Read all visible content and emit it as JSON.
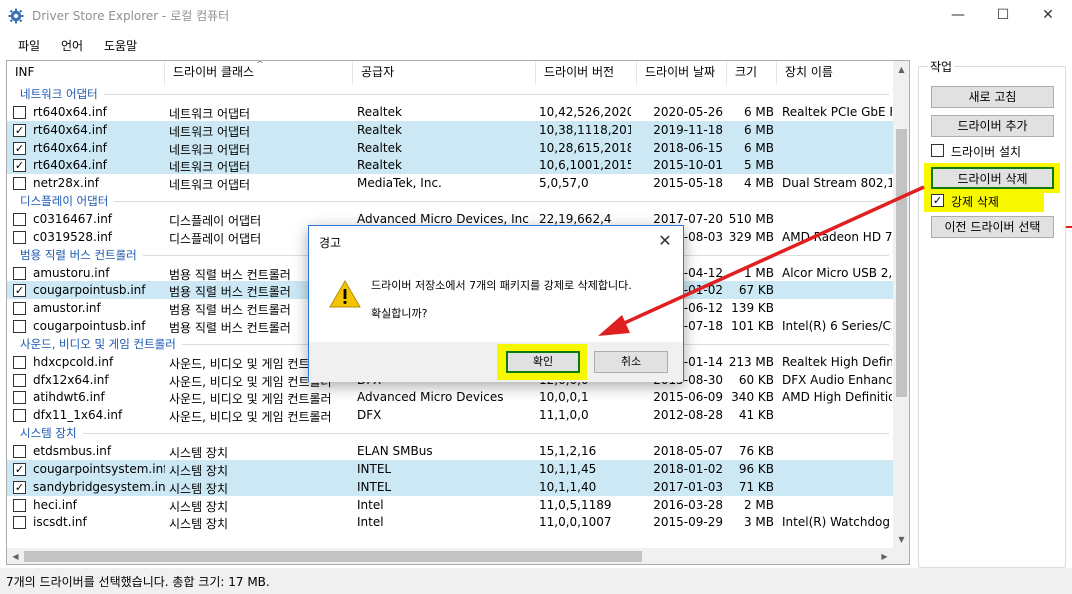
{
  "window": {
    "title": "Driver Store Explorer - 로컬 컴퓨터",
    "minimize_glyph": "—",
    "maximize_glyph": "☐",
    "close_glyph": "✕"
  },
  "menu": [
    {
      "label": "파일"
    },
    {
      "label": "언어"
    },
    {
      "label": "도움말"
    }
  ],
  "table": {
    "columns": [
      "INF",
      "드라이버 클래스",
      "공급자",
      "드라이버 버전",
      "드라이버 날짜",
      "크기",
      "장치 이름"
    ],
    "sort_indicator": "^",
    "groups": [
      {
        "label": "네트워크 어댑터",
        "rows": [
          {
            "checked": false,
            "selected": false,
            "inf": "rt640x64.inf",
            "class": "네트워크 어댑터",
            "provider": "Realtek",
            "version": "10,42,526,2020",
            "date": "2020-05-26",
            "size": "6 MB",
            "device": "Realtek PCIe GbE F"
          },
          {
            "checked": true,
            "selected": true,
            "inf": "rt640x64.inf",
            "class": "네트워크 어댑터",
            "provider": "Realtek",
            "version": "10,38,1118,2019",
            "date": "2019-11-18",
            "size": "6 MB",
            "device": ""
          },
          {
            "checked": true,
            "selected": true,
            "inf": "rt640x64.inf",
            "class": "네트워크 어댑터",
            "provider": "Realtek",
            "version": "10,28,615,2018",
            "date": "2018-06-15",
            "size": "6 MB",
            "device": ""
          },
          {
            "checked": true,
            "selected": true,
            "inf": "rt640x64.inf",
            "class": "네트워크 어댑터",
            "provider": "Realtek",
            "version": "10,6,1001,2015",
            "date": "2015-10-01",
            "size": "5 MB",
            "device": ""
          },
          {
            "checked": false,
            "selected": false,
            "inf": "netr28x.inf",
            "class": "네트워크 어댑터",
            "provider": "MediaTek, Inc.",
            "version": "5,0,57,0",
            "date": "2015-05-18",
            "size": "4 MB",
            "device": "Dual Stream 802,11n"
          }
        ]
      },
      {
        "label": "디스플레이 어댑터",
        "rows": [
          {
            "checked": false,
            "selected": false,
            "inf": "c0316467.inf",
            "class": "디스플레이 어댑터",
            "provider": "Advanced Micro Devices, Inc",
            "version": "22,19,662,4",
            "date": "2017-07-20",
            "size": "510 MB",
            "device": ""
          },
          {
            "checked": false,
            "selected": false,
            "inf": "c0319528.inf",
            "class": "디스플레이 어댑터",
            "provider": "",
            "version": "",
            "date": "5-08-03",
            "size": "329 MB",
            "device": "AMD Radeon HD 70"
          }
        ]
      },
      {
        "label": "범용 직렬 버스 컨트롤러",
        "rows": [
          {
            "checked": false,
            "selected": false,
            "inf": "amustoru.inf",
            "class": "범용 직렬 버스 컨트롤러",
            "provider": "",
            "version": "",
            "date": "0-04-12",
            "size": "1 MB",
            "device": "Alcor Micro USB 2,0"
          },
          {
            "checked": true,
            "selected": true,
            "inf": "cougarpointusb.inf",
            "class": "범용 직렬 버스 컨트롤러",
            "provider": "",
            "version": "",
            "date": "0-01-02",
            "size": "67 KB",
            "device": ""
          },
          {
            "checked": false,
            "selected": false,
            "inf": "amustor.inf",
            "class": "범용 직렬 버스 컨트롤러",
            "provider": "",
            "version": "",
            "date": "2-06-12",
            "size": "139 KB",
            "device": ""
          },
          {
            "checked": false,
            "selected": false,
            "inf": "cougarpointusb.inf",
            "class": "범용 직렬 버스 컨트롤러",
            "provider": "",
            "version": "",
            "date": "0-07-18",
            "size": "101 KB",
            "device": "Intel(R) 6 Series/C2"
          }
        ]
      },
      {
        "label": "사운드, 비디오 및 게임 컨트롤러",
        "rows": [
          {
            "checked": false,
            "selected": false,
            "inf": "hdxcpcold.inf",
            "class": "사운드, 비디오 및 게임 컨트롤러",
            "provider": "",
            "version": "",
            "date": "0-01-14",
            "size": "213 MB",
            "device": "Realtek High Definiti"
          },
          {
            "checked": false,
            "selected": false,
            "inf": "dfx12x64.inf",
            "class": "사운드, 비디오 및 게임 컨트롤러",
            "provider": "DFX",
            "version": "12,0,0,0",
            "date": "2015-08-30",
            "size": "60 KB",
            "device": "DFX Audio Enhance"
          },
          {
            "checked": false,
            "selected": false,
            "inf": "atihdwt6.inf",
            "class": "사운드, 비디오 및 게임 컨트롤러",
            "provider": "Advanced Micro Devices",
            "version": "10,0,0,1",
            "date": "2015-06-09",
            "size": "340 KB",
            "device": "AMD High Definition"
          },
          {
            "checked": false,
            "selected": false,
            "inf": "dfx11_1x64.inf",
            "class": "사운드, 비디오 및 게임 컨트롤러",
            "provider": "DFX",
            "version": "11,1,0,0",
            "date": "2012-08-28",
            "size": "41 KB",
            "device": ""
          }
        ]
      },
      {
        "label": "시스템 장치",
        "rows": [
          {
            "checked": false,
            "selected": false,
            "inf": "etdsmbus.inf",
            "class": "시스템 장치",
            "provider": "ELAN SMBus",
            "version": "15,1,2,16",
            "date": "2018-05-07",
            "size": "76 KB",
            "device": ""
          },
          {
            "checked": true,
            "selected": true,
            "inf": "cougarpointsystem.inf",
            "class": "시스템 장치",
            "provider": "INTEL",
            "version": "10,1,1,45",
            "date": "2018-01-02",
            "size": "96 KB",
            "device": ""
          },
          {
            "checked": true,
            "selected": true,
            "inf": "sandybridgesystem.inf",
            "class": "시스템 장치",
            "provider": "INTEL",
            "version": "10,1,1,40",
            "date": "2017-01-03",
            "size": "71 KB",
            "device": ""
          },
          {
            "checked": false,
            "selected": false,
            "inf": "heci.inf",
            "class": "시스템 장치",
            "provider": "Intel",
            "version": "11,0,5,1189",
            "date": "2016-03-28",
            "size": "2 MB",
            "device": ""
          },
          {
            "checked": false,
            "selected": false,
            "inf": "iscsdt.inf",
            "class": "시스템 장치",
            "provider": "Intel",
            "version": "11,0,0,1007",
            "date": "2015-09-29",
            "size": "3 MB",
            "device": "Intel(R) Watchdog T"
          }
        ]
      }
    ]
  },
  "tasks": {
    "label": "작업",
    "refresh": "새로 고침",
    "add_driver": "드라이버 추가",
    "install_driver": "드라이버 설치",
    "delete_driver": "드라이버 삭제",
    "force_delete": "강제 삭제",
    "force_delete_checked": true,
    "install_checked": false,
    "select_old": "이전 드라이버 선택"
  },
  "status": {
    "text": "7개의 드라이버를 선택했습니다. 총합 크기: 17 MB."
  },
  "dialog": {
    "title": "경고",
    "message": "드라이버 저장소에서 7개의 패키지를 강제로 삭제합니다.",
    "question": "확실합니까?",
    "ok": "확인",
    "cancel": "취소",
    "close_glyph": "✕"
  },
  "colors": {
    "highlight": "#f7f700",
    "arrow": "#e02020",
    "selected_row": "#cce8f5",
    "group_text": "#1a57b0"
  }
}
